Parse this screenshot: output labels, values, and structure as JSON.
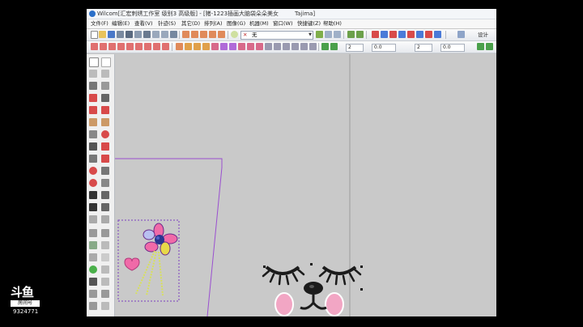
{
  "window": {
    "title": "Wilcom[汇宏刺绣工作室  级别3 高级版] - [猪-1223插画大脑袋朵朵美女",
    "machine_format": "Tajima]"
  },
  "menu": [
    "文件(F)",
    "编辑(E)",
    "查看(V)",
    "针迹(S)",
    "其它(D)",
    "排列(A)",
    "图像(G)",
    "机器(M)",
    "窗口(W)",
    "快捷键(Z)",
    "帮助(H)"
  ],
  "toolbar": {
    "color_combo_value": "无",
    "spin1": "2",
    "spin2": "0.0",
    "spin3": "2",
    "spin4": "0.0",
    "design_label": "设计"
  },
  "watermark": {
    "logo": "斗鱼",
    "subtitle": "房间号",
    "room_number": "9324771"
  },
  "colors": {
    "selection_box": "#7a3fc0",
    "hoop_outline": "#9a4fd0",
    "guide_line": "#9a9a9a",
    "canvas_bg": "#c9c9c9",
    "flower_pink": "#f06aa8",
    "flower_center": "#2a3590",
    "stem_yellow": "#d8e05a",
    "face_black": "#1b1b1b",
    "cheek_pink": "#f2a6c4"
  },
  "icons": {
    "left_toolbar": [
      "select-arrow-icon",
      "reshape-icon",
      "stitch-icon",
      "satin-icon",
      "fill-icon",
      "circle-icon",
      "lettering-icon",
      "monogram-icon",
      "appliqué-icon",
      "trace-icon"
    ]
  }
}
